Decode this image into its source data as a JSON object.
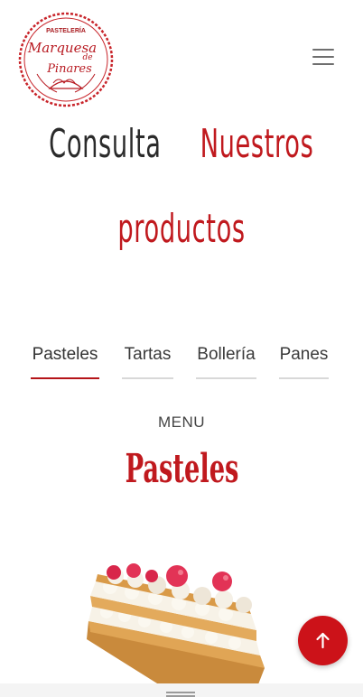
{
  "header": {
    "logo": {
      "top_text": "PASTELERÍA",
      "name_line1": "Marquesa",
      "name_line2": "de",
      "name_line3": "Pinares"
    },
    "menu_icon": "hamburger-icon"
  },
  "hero": {
    "word1": "Consulta",
    "word2": "Nuestros",
    "word3": "productos"
  },
  "tabs": [
    {
      "label": "Pasteles",
      "active": true
    },
    {
      "label": "Tartas",
      "active": false
    },
    {
      "label": "Bollería",
      "active": false
    },
    {
      "label": "Panes",
      "active": false
    }
  ],
  "section": {
    "eyebrow": "MENU",
    "title": "Pasteles"
  },
  "scroll_top_icon": "arrow-up-icon",
  "colors": {
    "brand_red": "#c0191e",
    "fab_red": "#cc1219",
    "text_dark": "#2b2b2b"
  }
}
